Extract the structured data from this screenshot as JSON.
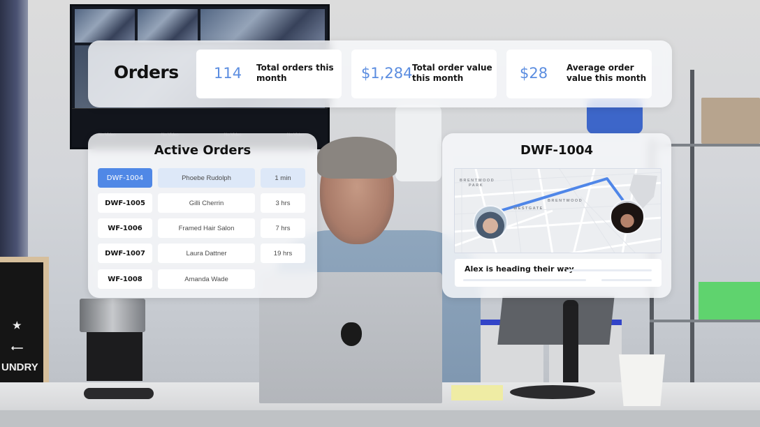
{
  "orders_header": {
    "title": "Orders",
    "stats": [
      {
        "value": "114",
        "label_line1": "Total orders this",
        "label_line2": "month"
      },
      {
        "value": "$1,284",
        "label_line1": "Total order value",
        "label_line2": "this month"
      },
      {
        "value": "$28",
        "label_line1": "Average order",
        "label_line2": "value this month"
      }
    ]
  },
  "active_orders": {
    "title": "Active Orders",
    "rows": [
      {
        "id": "DWF-1004",
        "customer": "Phoebe Rudolph",
        "time": "1 min",
        "selected": true
      },
      {
        "id": "DWF-1005",
        "customer": "Gilli Cherrin",
        "time": "3 hrs",
        "selected": false
      },
      {
        "id": "WF-1006",
        "customer": "Framed Hair Salon",
        "time": "7 hrs",
        "selected": false
      },
      {
        "id": "DWF-1007",
        "customer": "Laura Dattner",
        "time": "19 hrs",
        "selected": false
      },
      {
        "id": "WF-1008",
        "customer": "Amanda Wade",
        "time": "",
        "selected": false
      }
    ]
  },
  "order_detail": {
    "title": "DWF-1004",
    "map_labels": [
      "BRENTWOOD",
      "PARK",
      "BRENTWOOD",
      "WESTGATE"
    ],
    "status": "Alex is heading their way"
  },
  "background": {
    "tv_labels": [
      "No Video",
      "No Video",
      "No Video",
      "No Video"
    ],
    "letterboard_text": "UNDRY"
  },
  "colors": {
    "accent": "#5088e6",
    "stat_value": "#5b8de0",
    "selected_row_bg": "#dde8f8",
    "route": "#4f86e8"
  }
}
